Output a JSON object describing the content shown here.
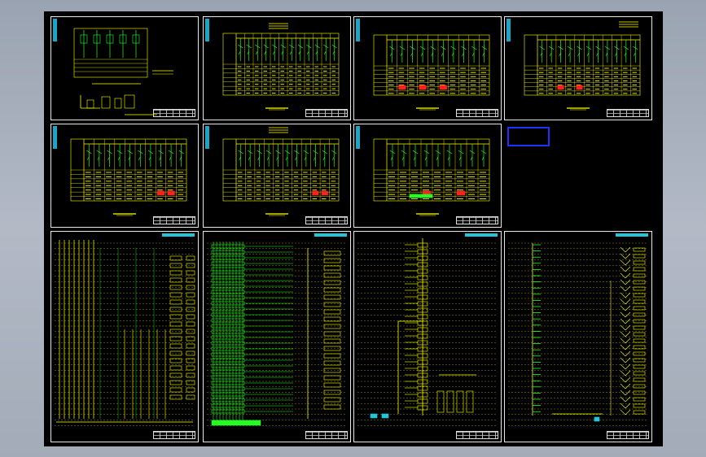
{
  "drawing": {
    "sheets": [
      {
        "id": "sheet-1-1",
        "kind": "panel-schematic",
        "caption": ""
      },
      {
        "id": "sheet-1-2",
        "kind": "panel-schedule",
        "caption": ""
      },
      {
        "id": "sheet-1-3",
        "kind": "panel-schedule",
        "caption": ""
      },
      {
        "id": "sheet-1-4",
        "kind": "panel-schedule",
        "caption": ""
      },
      {
        "id": "sheet-2-1",
        "kind": "panel-schedule",
        "caption": ""
      },
      {
        "id": "sheet-2-2",
        "kind": "panel-schedule",
        "caption": ""
      },
      {
        "id": "sheet-2-3",
        "kind": "panel-schedule",
        "caption": ""
      },
      {
        "id": "sheet-3-1",
        "kind": "riser-diagram",
        "caption": ""
      },
      {
        "id": "sheet-3-2",
        "kind": "riser-diagram-green",
        "caption": ""
      },
      {
        "id": "sheet-3-3",
        "kind": "riser-diagram",
        "caption": ""
      },
      {
        "id": "sheet-3-4",
        "kind": "riser-diagram",
        "caption": ""
      }
    ],
    "notice": {
      "lines": [
        "",
        "",
        "",
        ""
      ]
    },
    "colors": {
      "background": "#000000",
      "viewport": "#a5adba",
      "line_yellow": "#ffff00",
      "line_green": "#22ff22",
      "line_red": "#ff2020",
      "line_cyan": "#22c5d8",
      "notice_border": "#2030ff",
      "sheet_border": "#e8e8e8"
    }
  }
}
